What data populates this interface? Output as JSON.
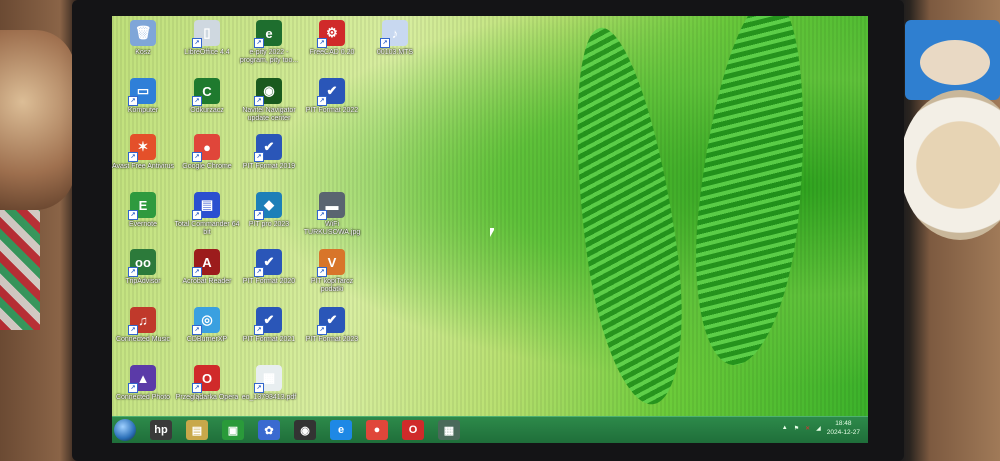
{
  "desktop": {
    "columns": [
      [
        {
          "label": "Kosz",
          "icon": "recycle-bin-icon",
          "color": "#7fa6d8",
          "glyph": "🗑"
        },
        {
          "label": "Komputer",
          "icon": "computer-icon",
          "color": "#2f7fd8",
          "glyph": "▭"
        },
        {
          "label": "Avast Free Antivirus",
          "icon": "avast-icon",
          "color": "#e4502a",
          "glyph": "✶"
        },
        {
          "label": "Evernote",
          "icon": "evernote-icon",
          "color": "#2e9a3e",
          "glyph": "E"
        },
        {
          "label": "TripAdvisor",
          "icon": "tripadvisor-icon",
          "color": "#2c7a3a",
          "glyph": "oo"
        },
        {
          "label": "Connected Music",
          "icon": "connected-music-icon",
          "color": "#c0392b",
          "glyph": "♫"
        },
        {
          "label": "Connected Photo",
          "icon": "connected-photo-icon",
          "color": "#5b3aa8",
          "glyph": "▲"
        }
      ],
      [
        {
          "label": "LibreOffice 4.4",
          "icon": "libreoffice-icon",
          "color": "#cfd8e0",
          "glyph": "▯"
        },
        {
          "label": "Odkurzacz",
          "icon": "ccleaner-icon",
          "color": "#1f7a2e",
          "glyph": "C"
        },
        {
          "label": "Google Chrome",
          "icon": "chrome-icon",
          "color": "#e0463a",
          "glyph": "●"
        },
        {
          "label": "Total Commander 64 bit",
          "icon": "total-commander-icon",
          "color": "#2a4fd0",
          "glyph": "▤"
        },
        {
          "label": "Acrobat Reader",
          "icon": "acrobat-reader-icon",
          "color": "#9c1c1c",
          "glyph": "A"
        },
        {
          "label": "CDBurnerXP",
          "icon": "cdburnerxp-icon",
          "color": "#3aa0e0",
          "glyph": "◎"
        },
        {
          "label": "Przeglądarka Opera",
          "icon": "opera-icon",
          "color": "#d02a2a",
          "glyph": "O"
        }
      ],
      [
        {
          "label": "e-pity 2022 - program, pity too...",
          "icon": "e-pity-icon",
          "color": "#1e6e2e",
          "glyph": "e"
        },
        {
          "label": "Navitel Navigator update center",
          "icon": "navitel-icon",
          "color": "#1a5a1e",
          "glyph": "◉"
        },
        {
          "label": "PIT Format 2019",
          "icon": "pit-format-icon",
          "color": "#2a56b8",
          "glyph": "✔"
        },
        {
          "label": "PIT pro 2023",
          "icon": "pit-pro-icon",
          "color": "#1d7fb8",
          "glyph": "◆"
        },
        {
          "label": "PIT Format 2020",
          "icon": "pit-format-icon",
          "color": "#2a56b8",
          "glyph": "✔"
        },
        {
          "label": "PIT Format 2021",
          "icon": "pit-format-icon",
          "color": "#2a56b8",
          "glyph": "✔"
        },
        {
          "label": "eo_13793413.pdf",
          "icon": "pdf-file-icon",
          "color": "#e8eef0",
          "glyph": "▦"
        }
      ],
      [
        {
          "label": "FreeCAD 0.20",
          "icon": "freecad-icon",
          "color": "#d02a2a",
          "glyph": "⚙"
        },
        {
          "label": "PIT Format 2022",
          "icon": "pit-format-icon",
          "color": "#2a56b8",
          "glyph": "✔"
        },
        null,
        {
          "label": "WiFi TURKUSOWA.jpg",
          "icon": "image-file-icon",
          "color": "#5a6470",
          "glyph": "▬"
        },
        {
          "label": "PIT kopiTarcz podatki",
          "icon": "pit-kopia-icon",
          "color": "#d8752a",
          "glyph": "V"
        },
        {
          "label": "PIT Format 2023",
          "icon": "pit-format-icon",
          "color": "#2a56b8",
          "glyph": "✔"
        }
      ],
      [
        {
          "label": "00103.MTS",
          "icon": "video-file-icon",
          "color": "#c8d8f0",
          "glyph": "♪"
        }
      ]
    ]
  },
  "taskbar": {
    "items": [
      {
        "name": "hp-icon",
        "glyph": "hp",
        "color": "#3a3a3a"
      },
      {
        "name": "libraries-icon",
        "glyph": "▤",
        "color": "#c8a84a"
      },
      {
        "name": "store-icon",
        "glyph": "▣",
        "color": "#2a9a3a"
      },
      {
        "name": "photo-gallery-icon",
        "glyph": "✿",
        "color": "#3a6ad0"
      },
      {
        "name": "webcam-icon",
        "glyph": "◉",
        "color": "#333"
      },
      {
        "name": "internet-explorer-icon",
        "glyph": "e",
        "color": "#1e88e5"
      },
      {
        "name": "chrome-icon",
        "glyph": "●",
        "color": "#e0463a"
      },
      {
        "name": "opera-icon",
        "glyph": "O",
        "color": "#d02a2a"
      },
      {
        "name": "calculator-icon",
        "glyph": "▦",
        "color": "#4a6a5a"
      }
    ],
    "tray": {
      "time": "18:48",
      "date": "2024-12-27"
    }
  }
}
